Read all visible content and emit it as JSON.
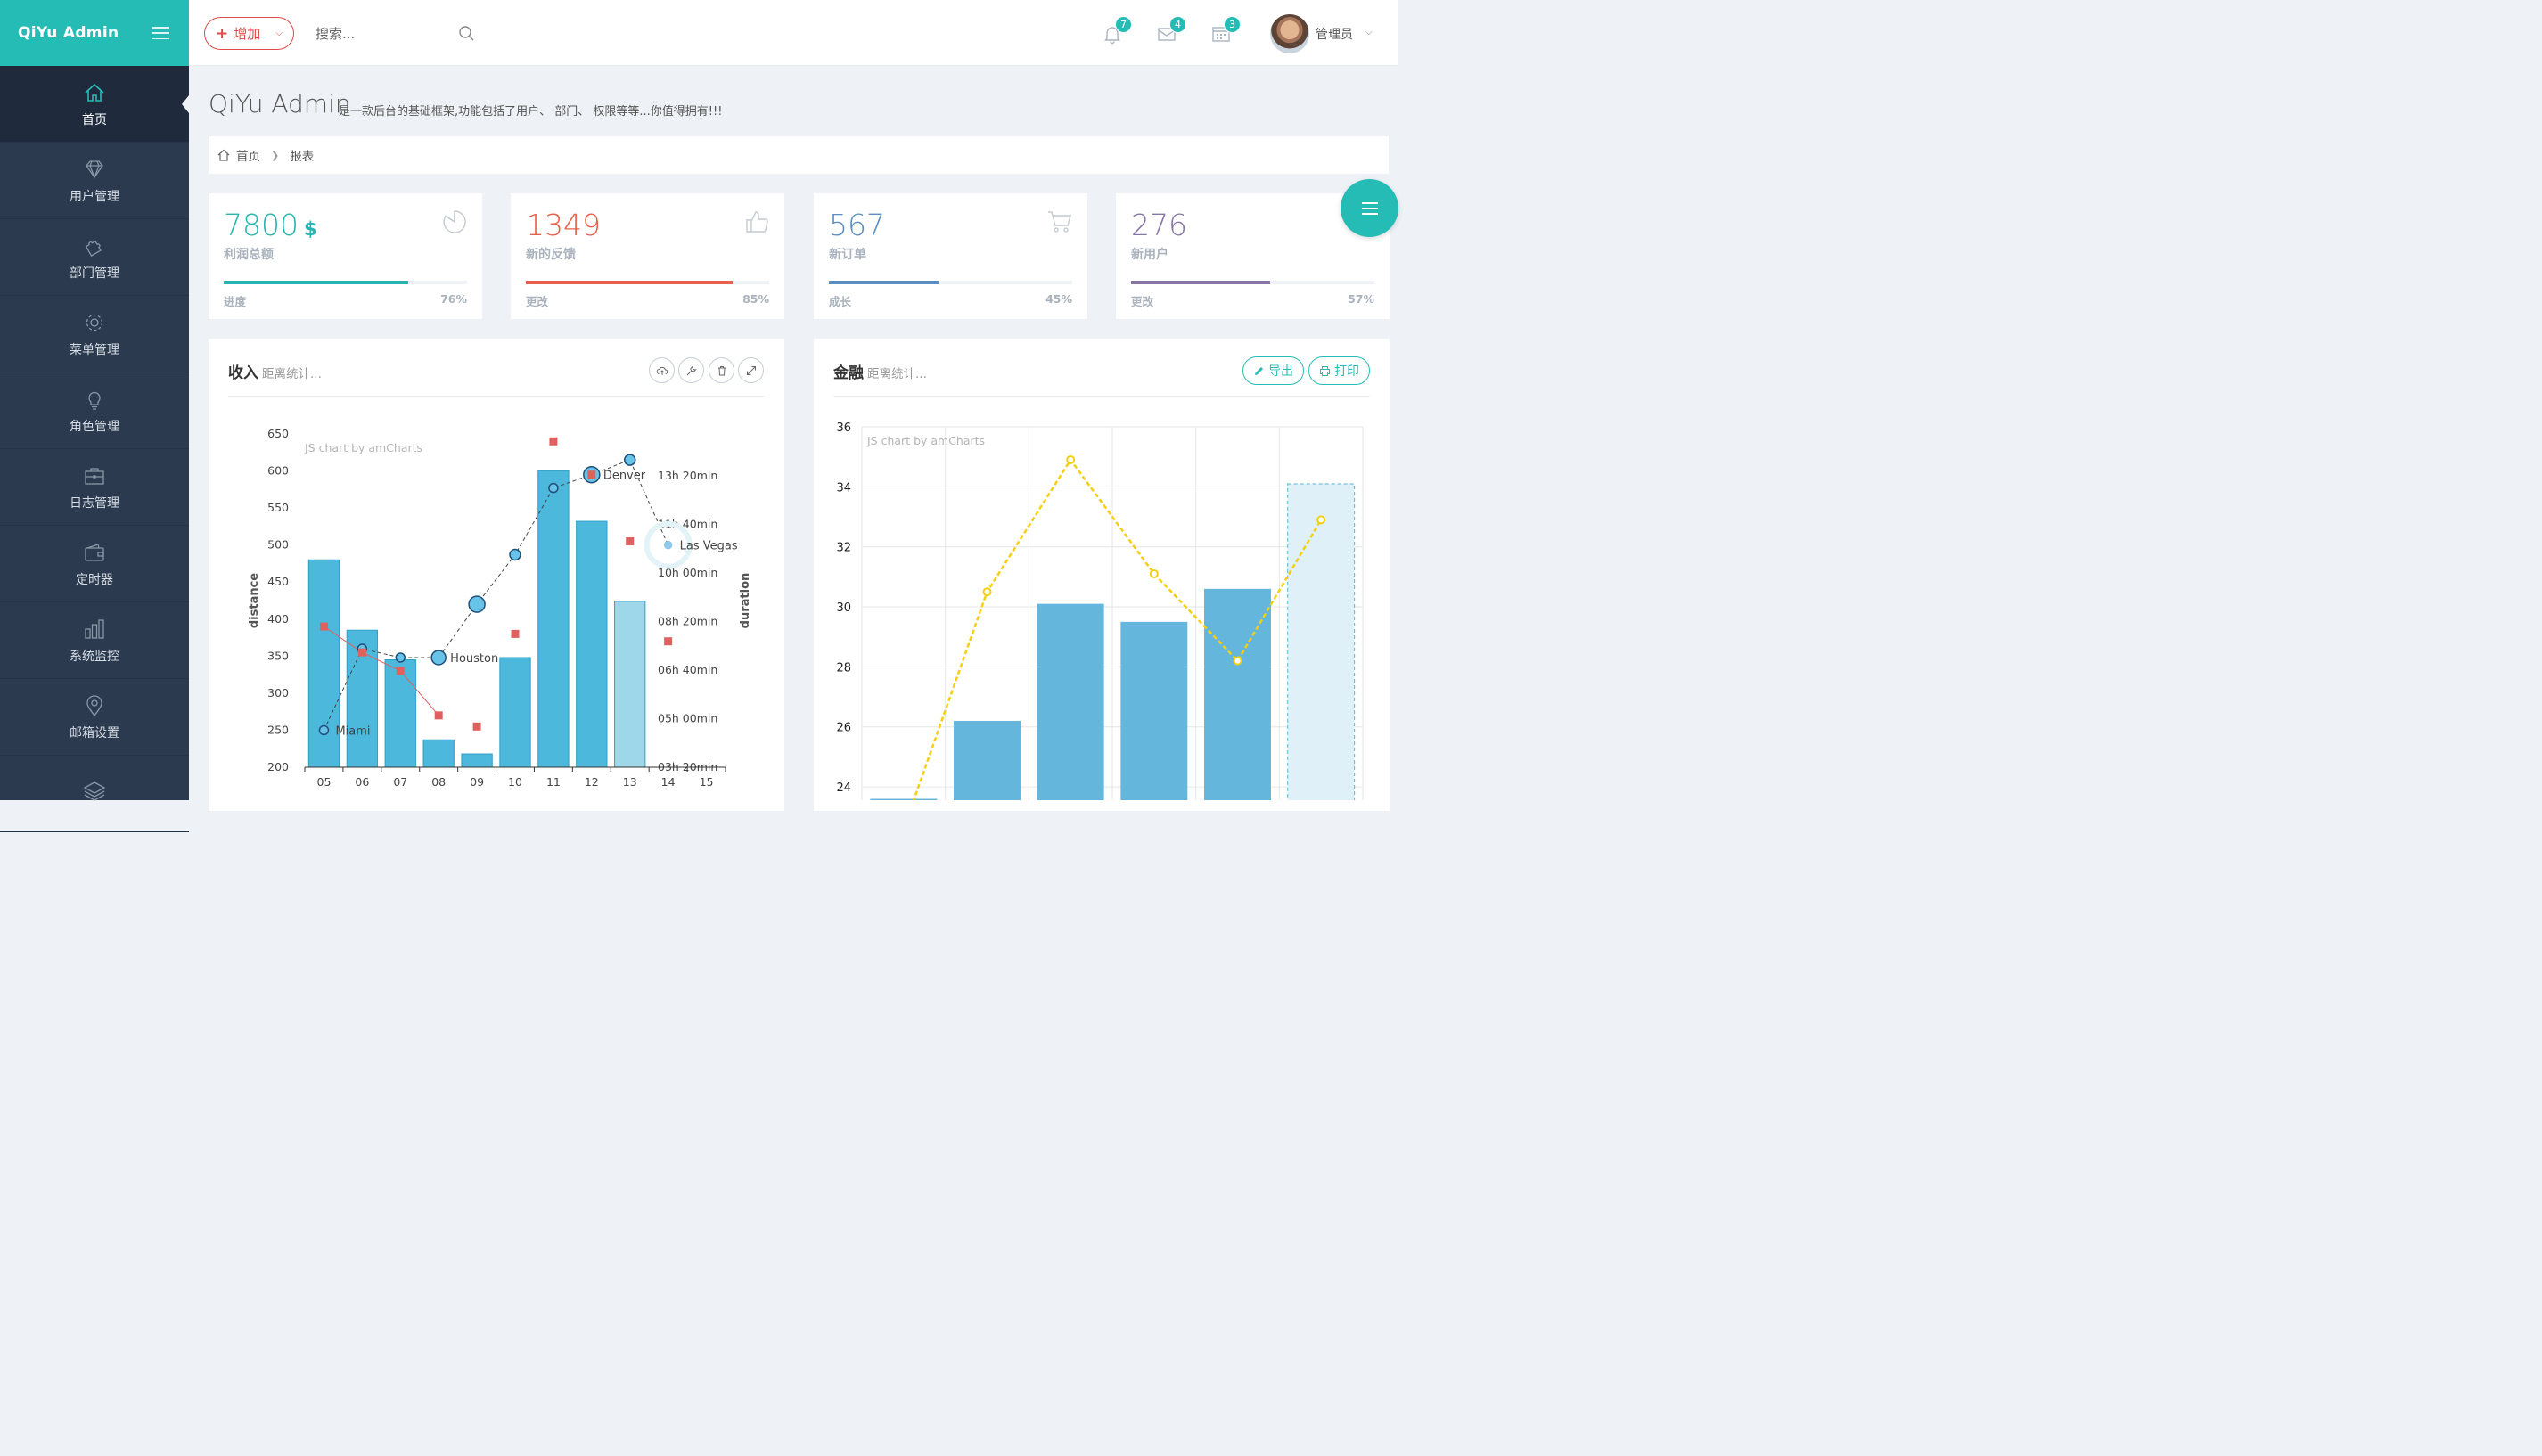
{
  "brand": {
    "title": "QiYu Admin"
  },
  "sidebar": {
    "items": [
      {
        "label": "首页",
        "icon": "home-icon",
        "active": true
      },
      {
        "label": "用户管理",
        "icon": "diamond-icon"
      },
      {
        "label": "部门管理",
        "icon": "puzzle-icon"
      },
      {
        "label": "菜单管理",
        "icon": "gear-icon"
      },
      {
        "label": "角色管理",
        "icon": "bulb-icon"
      },
      {
        "label": "日志管理",
        "icon": "briefcase-icon"
      },
      {
        "label": "定时器",
        "icon": "wallet-icon"
      },
      {
        "label": "系统监控",
        "icon": "bar-chart-icon"
      },
      {
        "label": "邮箱设置",
        "icon": "map-pin-icon"
      },
      {
        "label": "",
        "icon": "layers-icon"
      }
    ]
  },
  "header": {
    "add_label": "增加",
    "search_placeholder": "搜索...",
    "notifications": {
      "bell": "7",
      "mail": "4",
      "calendar": "3"
    },
    "user_name": "管理员"
  },
  "page": {
    "title": "QiYu Admin",
    "subtitle": "是一款后台的基础框架,功能包括了用户、 部门、 权限等等...你值得拥有!!!"
  },
  "breadcrumb": {
    "home": "首页",
    "current": "报表"
  },
  "stats": [
    {
      "value": "7800",
      "unit": "$",
      "label": "利润总额",
      "progress_label": "进度",
      "percent": 76,
      "percent_text": "76%",
      "color": "#26b5b0",
      "icon": "pie-chart-icon"
    },
    {
      "value": "1349",
      "unit": "",
      "label": "新的反馈",
      "progress_label": "更改",
      "percent": 85,
      "percent_text": "85%",
      "color": "#e7604a",
      "icon": "thumbs-up-icon"
    },
    {
      "value": "567",
      "unit": "",
      "label": "新订单",
      "progress_label": "成长",
      "percent": 45,
      "percent_text": "45%",
      "color": "#5b8fc3",
      "icon": "cart-icon"
    },
    {
      "value": "276",
      "unit": "",
      "label": "新用户",
      "progress_label": "更改",
      "percent": 57,
      "percent_text": "57%",
      "color": "#8775a7",
      "icon": "users-icon"
    }
  ],
  "panels": {
    "income": {
      "title": "收入",
      "subtitle": "距离统计..."
    },
    "finance": {
      "title": "金融",
      "subtitle": "距离统计...",
      "export_label": "导出",
      "print_label": "打印"
    }
  },
  "chart_data": [
    {
      "type": "bar",
      "watermark": "JS chart by amCharts",
      "categories": [
        "05",
        "06",
        "07",
        "08",
        "09",
        "10",
        "11",
        "12",
        "13",
        "14",
        "15"
      ],
      "ylabel": "distance",
      "y2label": "duration",
      "ylim": [
        200,
        650
      ],
      "y_ticks": [
        200,
        250,
        300,
        350,
        400,
        450,
        500,
        550,
        600,
        650
      ],
      "y2_ticks": [
        "03h 20min",
        "05h 00min",
        "06h 40min",
        "08h 20min",
        "10h 00min",
        "11h 40min",
        "13h 20min"
      ],
      "series": [
        {
          "values": [
            480,
            385,
            345,
            237,
            218,
            348,
            600,
            532,
            424,
            null,
            null
          ]
        },
        {
          "values": [
            250,
            360,
            348,
            348,
            420,
            487,
            577,
            595,
            615,
            500,
            null
          ]
        },
        {
          "values": [
            390,
            355,
            330,
            270,
            255,
            380,
            640,
            595,
            505,
            370,
            null
          ]
        }
      ],
      "point_labels": [
        {
          "category": "05",
          "text": "Miami"
        },
        {
          "category": "08",
          "text": "Houston"
        },
        {
          "category": "12",
          "text": "Denver"
        },
        {
          "category": "14",
          "text": "Las Vegas"
        }
      ]
    },
    {
      "type": "bar",
      "watermark": "JS chart by amCharts",
      "ylim": [
        23.2,
        36
      ],
      "y_ticks": [
        24,
        26,
        28,
        30,
        32,
        34,
        36
      ],
      "series": [
        {
          "values": [
            23.6,
            26.2,
            30.1,
            29.5,
            30.6,
            34.1
          ]
        },
        {
          "values": [
            22.6,
            30.5,
            34.9,
            31.1,
            28.2,
            32.9
          ]
        }
      ]
    }
  ]
}
